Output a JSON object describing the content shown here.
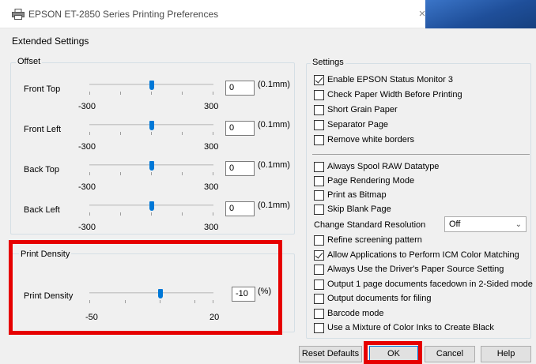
{
  "window": {
    "title": "EPSON ET-2850 Series Printing Preferences",
    "close_glyph": "×",
    "accent_color": "#1f4f9a"
  },
  "page": {
    "heading": "Extended Settings"
  },
  "offset": {
    "legend": "Offset",
    "rows": [
      {
        "label": "Front Top",
        "min": "-300",
        "max": "300",
        "value": "0",
        "unit": "(0.1mm)",
        "slider_fraction": 0.5
      },
      {
        "label": "Front Left",
        "min": "-300",
        "max": "300",
        "value": "0",
        "unit": "(0.1mm)",
        "slider_fraction": 0.5
      },
      {
        "label": "Back Top",
        "min": "-300",
        "max": "300",
        "value": "0",
        "unit": "(0.1mm)",
        "slider_fraction": 0.5
      },
      {
        "label": "Back Left",
        "min": "-300",
        "max": "300",
        "value": "0",
        "unit": "(0.1mm)",
        "slider_fraction": 0.5
      }
    ]
  },
  "print_density": {
    "legend": "Print Density",
    "label": "Print Density",
    "min": "-50",
    "max": "20",
    "value": "-10",
    "unit": "(%)",
    "slider_value": -10
  },
  "settings": {
    "legend": "Settings",
    "group1": [
      {
        "label": "Enable EPSON Status Monitor 3",
        "checked": true
      },
      {
        "label": "Check Paper Width Before Printing",
        "checked": false
      },
      {
        "label": "Short Grain Paper",
        "checked": false
      },
      {
        "label": "Separator Page",
        "checked": false
      },
      {
        "label": "Remove white borders",
        "checked": false
      }
    ],
    "group2": [
      {
        "label": "Always Spool RAW Datatype",
        "checked": false
      },
      {
        "label": "Page Rendering Mode",
        "checked": false
      },
      {
        "label": "Print as Bitmap",
        "checked": false
      },
      {
        "label": "Skip Blank Page",
        "checked": false
      }
    ],
    "resolution": {
      "label": "Change Standard Resolution",
      "selected": "Off"
    },
    "group3": [
      {
        "label": "Refine screening pattern",
        "checked": false
      },
      {
        "label": "Allow Applications to Perform ICM Color Matching",
        "checked": true
      },
      {
        "label": "Always Use the Driver's Paper Source Setting",
        "checked": false
      },
      {
        "label": "Output 1 page documents facedown in 2-Sided mode",
        "checked": false
      },
      {
        "label": "Output documents for filing",
        "checked": false
      },
      {
        "label": "Barcode mode",
        "checked": false
      },
      {
        "label": "Use a Mixture of Color Inks to Create Black",
        "checked": false
      }
    ]
  },
  "buttons": {
    "reset": "Reset Defaults",
    "ok": "OK",
    "cancel": "Cancel",
    "help": "Help"
  },
  "highlight_color": "#e60000"
}
